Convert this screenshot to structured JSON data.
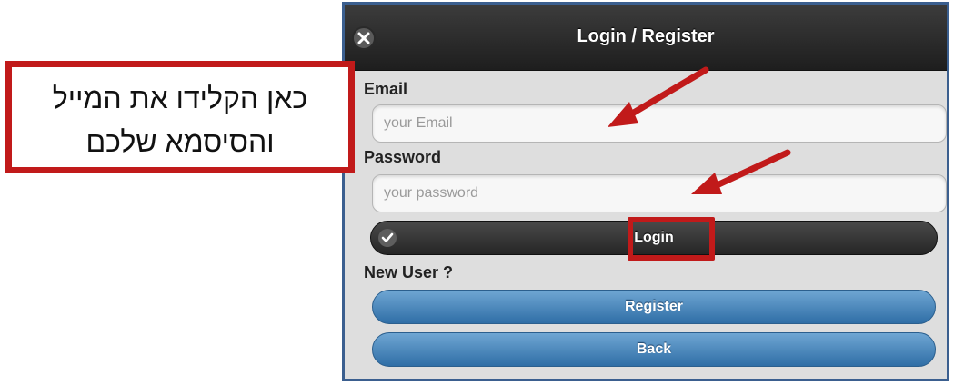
{
  "dialog": {
    "title": "Login / Register",
    "close_icon": "close-icon",
    "email_label": "Email",
    "email_placeholder": "your Email",
    "email_value": "",
    "password_label": "Password",
    "password_placeholder": "your password",
    "password_value": "",
    "login_label": "Login",
    "login_icon": "check-icon",
    "new_user_label": "New User ?",
    "register_label": "Register",
    "back_label": "Back"
  },
  "annotation": {
    "line1": "כאן הקלידו את המייל",
    "line2": "והסיסמא שלכם",
    "color": "#c11a1a"
  },
  "colors": {
    "header": "#1e1e1e",
    "blue_button": "#3f7fb6",
    "dialog_border": "#3b5f8f"
  }
}
